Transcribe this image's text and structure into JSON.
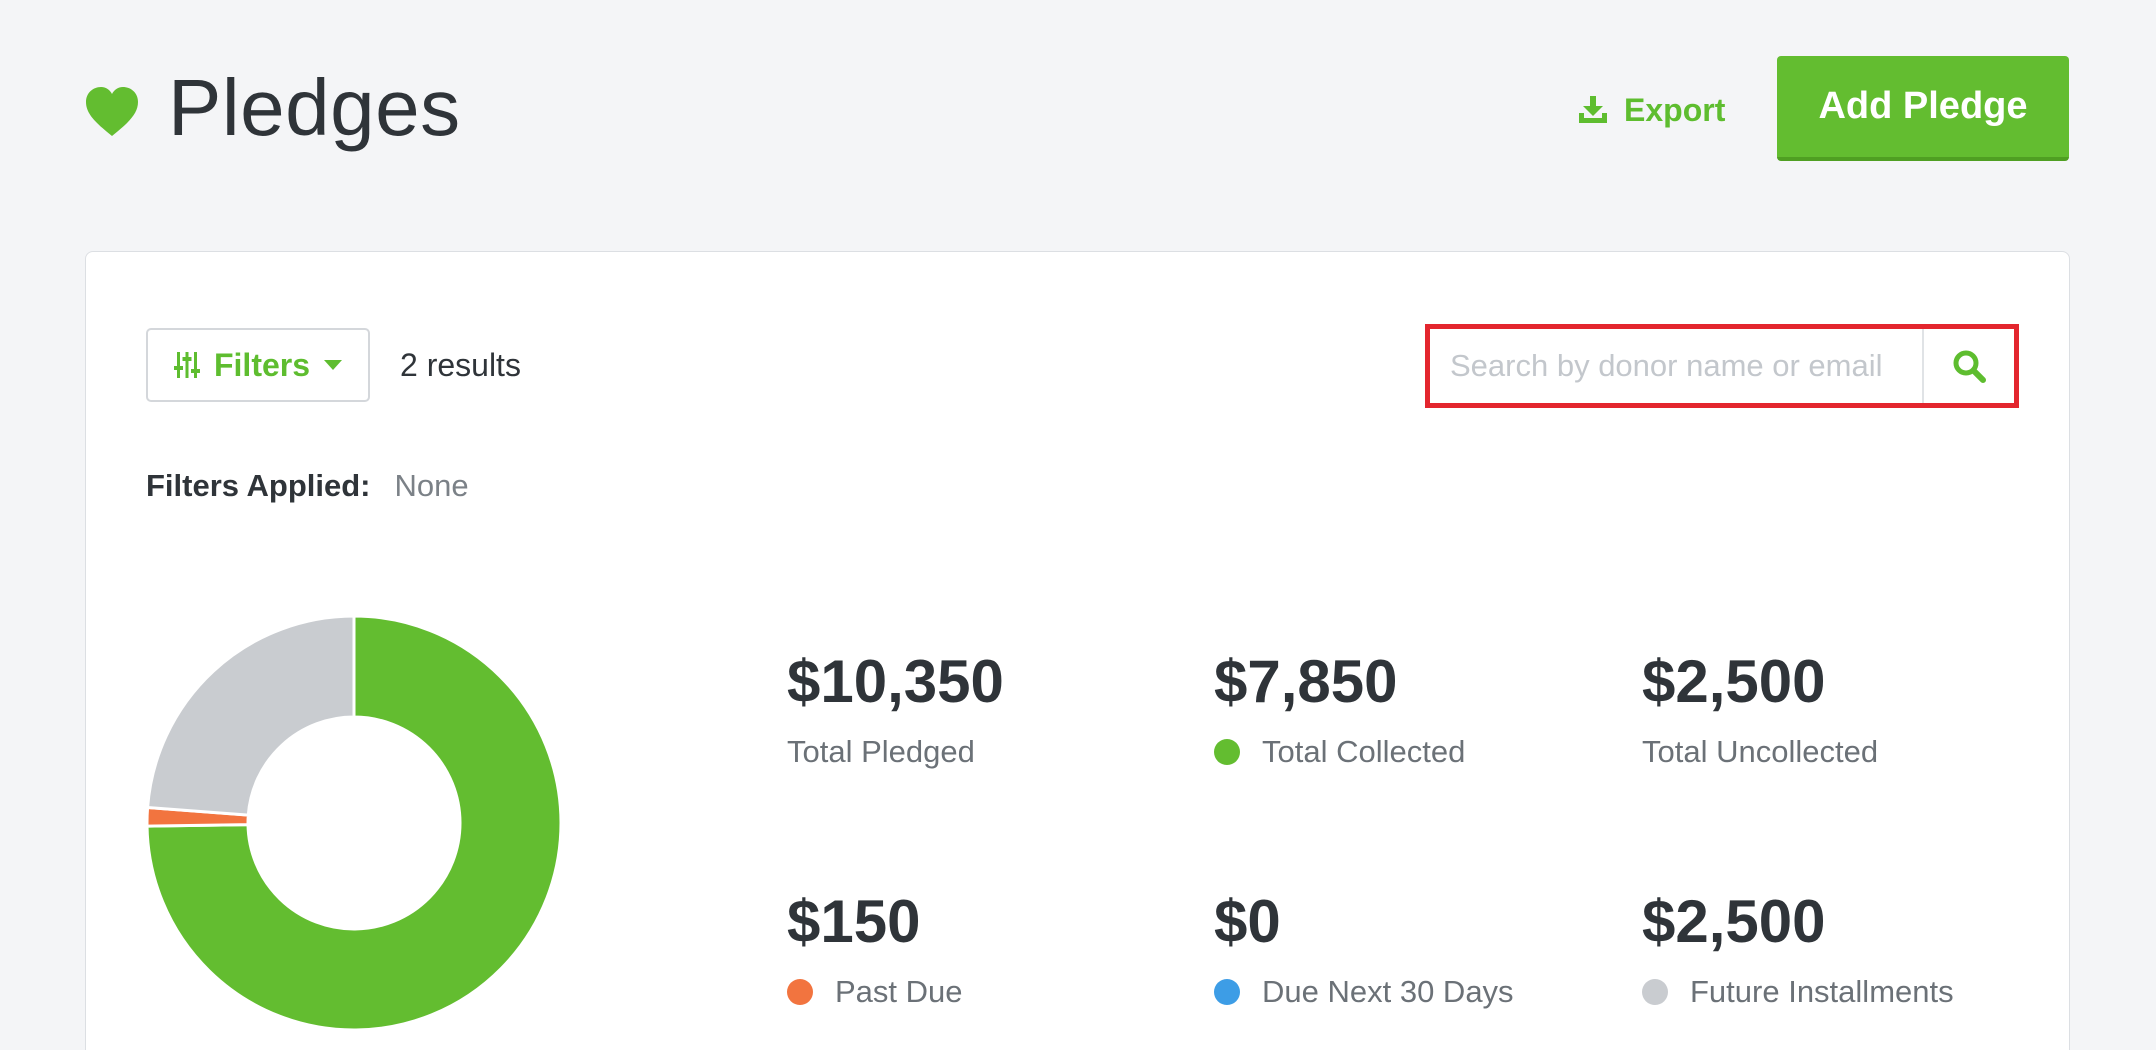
{
  "header": {
    "title": "Pledges",
    "icon": "heart-icon",
    "export_label": "Export",
    "add_label": "Add Pledge"
  },
  "toolbar": {
    "filters_label": "Filters",
    "results_text": "2 results",
    "search_placeholder": "Search by donor name or email",
    "filters_applied_label": "Filters Applied:",
    "filters_applied_value": "None"
  },
  "colors": {
    "accent": "#63bd30",
    "collected": "#63bd30",
    "past_due": "#f2743f",
    "due_next_30": "#3d9de6",
    "future": "#c9ccd0",
    "highlight_border": "#e3262e"
  },
  "chart_data": {
    "type": "pie",
    "donut": true,
    "labels": [
      "Total Collected",
      "Past Due",
      "Due Next 30 Days",
      "Future Installments"
    ],
    "values": [
      7850,
      150,
      0,
      2500
    ],
    "colors": [
      "#63bd30",
      "#f2743f",
      "#3d9de6",
      "#c9ccd0"
    ]
  },
  "stats": [
    {
      "value": "$10,350",
      "label": "Total Pledged"
    },
    {
      "value": "$7,850",
      "label": "Total Collected"
    },
    {
      "value": "$2,500",
      "label": "Total Uncollected"
    },
    {
      "value": "$150",
      "label": "Past Due"
    },
    {
      "value": "$0",
      "label": "Due Next 30 Days"
    },
    {
      "value": "$2,500",
      "label": "Future Installments"
    }
  ]
}
